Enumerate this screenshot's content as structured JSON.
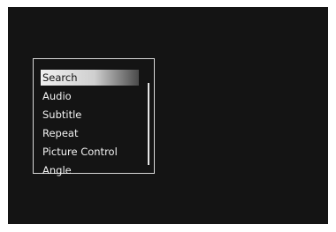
{
  "menu": {
    "items": [
      {
        "label": "Search",
        "selected": true
      },
      {
        "label": "Audio",
        "selected": false
      },
      {
        "label": "Subtitle",
        "selected": false
      },
      {
        "label": "Repeat",
        "selected": false
      },
      {
        "label": "Picture Control",
        "selected": false
      },
      {
        "label": "Angle",
        "selected": false
      }
    ]
  },
  "colors": {
    "screen_background": "#141414",
    "menu_border": "#d8d8d8",
    "text": "#f2f2f2",
    "highlight": "#f0f0f0"
  }
}
